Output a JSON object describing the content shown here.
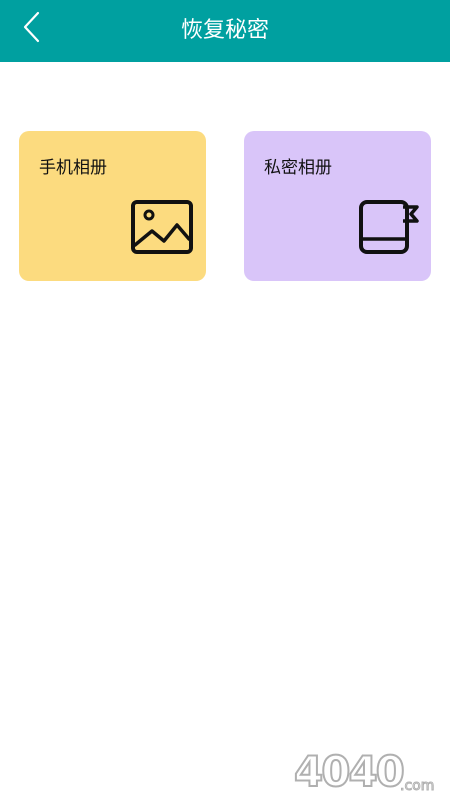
{
  "header": {
    "title": "恢复秘密",
    "back_icon": "chevron-left-icon",
    "background": "#00a0a0"
  },
  "cards": [
    {
      "label": "手机相册",
      "icon": "image-icon",
      "color": "#fcdb7f"
    },
    {
      "label": "私密相册",
      "icon": "book-bookmark-icon",
      "color": "#d9c5f9"
    }
  ],
  "watermark": {
    "text": "4040",
    "suffix": ".com"
  }
}
